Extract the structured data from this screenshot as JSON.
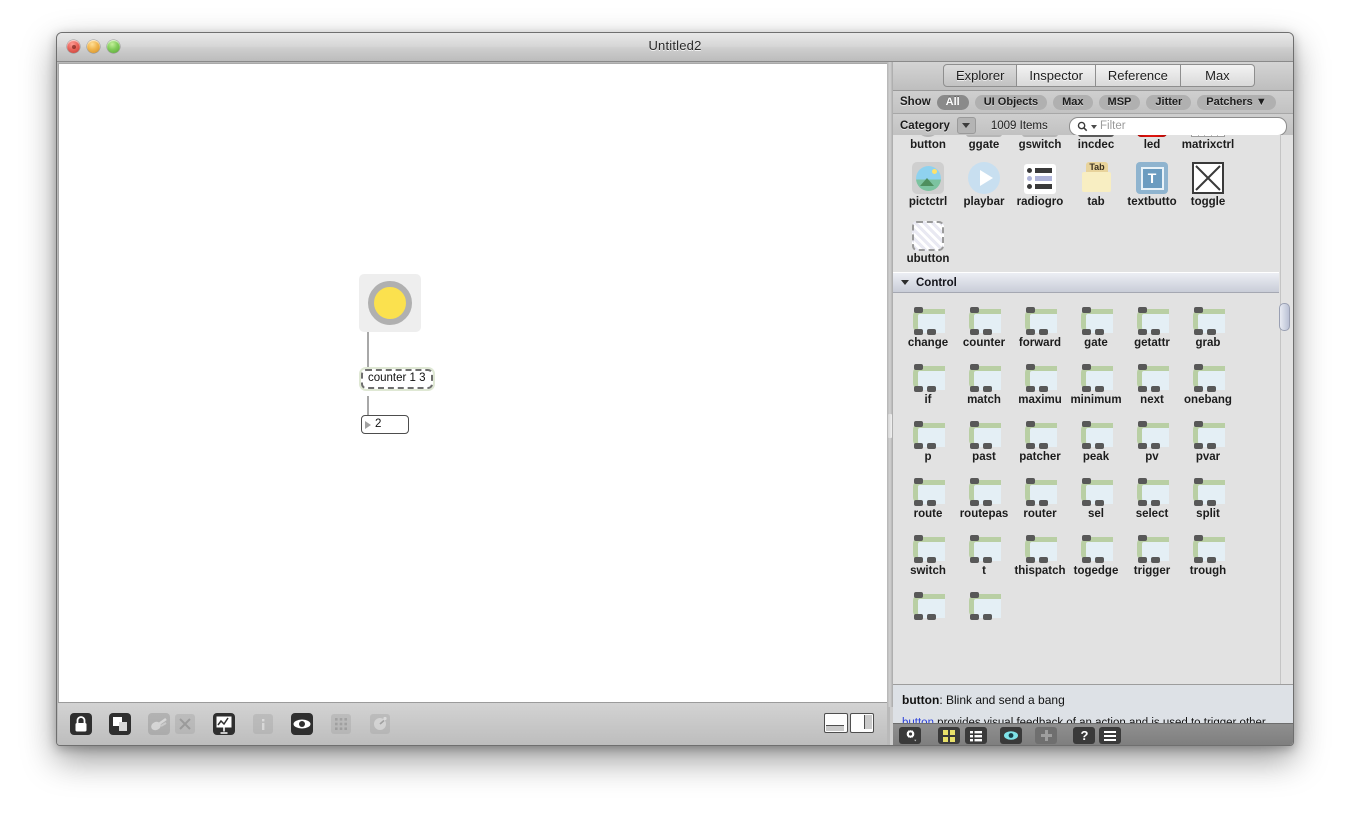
{
  "window": {
    "title": "Untitled2",
    "traffic_lights": [
      "close-button",
      "minimize-button",
      "zoom-button"
    ]
  },
  "patcher": {
    "objects": [
      {
        "type": "bang",
        "name": "bang-object",
        "value": ""
      },
      {
        "type": "object-box",
        "name": "counter-object-box",
        "text": "counter 1 3",
        "selected": true
      },
      {
        "type": "number-box",
        "name": "number-box",
        "text": "2"
      }
    ]
  },
  "patcher_toolbar": {
    "items": [
      {
        "name": "lock-icon",
        "label": "Lock",
        "enabled": true
      },
      {
        "name": "presentation-mode-icon",
        "label": "Presentation",
        "enabled": true
      },
      {
        "name": "scope-icon",
        "label": "Scope",
        "enabled": false
      },
      {
        "name": "close-x-icon",
        "label": "Close",
        "enabled": false
      },
      {
        "name": "signal-probe-icon",
        "label": "Signal Probe",
        "enabled": true
      },
      {
        "name": "info-icon",
        "label": "Info",
        "enabled": false
      },
      {
        "name": "snap-icon",
        "label": "Snap",
        "enabled": true
      },
      {
        "name": "grid-icon",
        "label": "Grid",
        "enabled": false
      },
      {
        "name": "gauge-icon",
        "label": "Gauge",
        "enabled": false
      }
    ],
    "panel_toggles": [
      {
        "name": "bottom-panel-toggle",
        "label": "Bottom Panel"
      },
      {
        "name": "side-panel-toggle",
        "label": "Side Panel"
      }
    ]
  },
  "sidebar": {
    "tabs": [
      {
        "label": "Explorer",
        "active": true
      },
      {
        "label": "Inspector",
        "active": false
      },
      {
        "label": "Reference",
        "active": false
      },
      {
        "label": "Max",
        "active": false
      }
    ],
    "show_row": {
      "label": "Show",
      "filters": [
        {
          "label": "All",
          "selected": true
        },
        {
          "label": "UI Objects",
          "selected": false
        },
        {
          "label": "Max",
          "selected": false
        },
        {
          "label": "MSP",
          "selected": false
        },
        {
          "label": "Jitter",
          "selected": false
        },
        {
          "label": "Patchers ▼",
          "selected": false
        }
      ]
    },
    "category_row": {
      "label": "Category",
      "items_count": "1009 Items",
      "search_placeholder": "Filter",
      "search_value": ""
    },
    "ui_objects": [
      {
        "label": "button",
        "icon": "bang-icon"
      },
      {
        "label": "ggate",
        "icon": "ggate-icon"
      },
      {
        "label": "gswitch",
        "icon": "gswitch-icon"
      },
      {
        "label": "incdec",
        "icon": "incdec-icon"
      },
      {
        "label": "led",
        "icon": "led-icon"
      },
      {
        "label": "matrixctrl",
        "icon": "matrixctrl-icon"
      },
      {
        "label": "pictctrl",
        "icon": "pictctrl-icon"
      },
      {
        "label": "playbar",
        "icon": "playbar-icon"
      },
      {
        "label": "radiogro",
        "icon": "radiogroup-icon"
      },
      {
        "label": "tab",
        "icon": "tab-icon"
      },
      {
        "label": "textbutto",
        "icon": "textbutton-icon"
      },
      {
        "label": "toggle",
        "icon": "toggle-icon"
      },
      {
        "label": "ubutton",
        "icon": "ubutton-icon"
      }
    ],
    "control_section": {
      "title": "Control",
      "expanded": true,
      "objects": [
        "change",
        "counter",
        "forward",
        "gate",
        "getattr",
        "grab",
        "if",
        "match",
        "maximu",
        "minimum",
        "next",
        "onebang",
        "p",
        "past",
        "patcher",
        "peak",
        "pv",
        "pvar",
        "route",
        "routepas",
        "router",
        "sel",
        "select",
        "split",
        "switch",
        "t",
        "thispatch",
        "togedge",
        "trigger",
        "trough",
        "",
        ""
      ]
    },
    "description": {
      "heading_object": "button",
      "heading_rest": ": Blink and send a bang",
      "body_link": "button",
      "body_rest": " provides visual feedback of an action and is used to trigger other messages and processes."
    },
    "bottom_toolbar": [
      {
        "name": "gear-icon",
        "label": "Settings",
        "state": "normal"
      },
      {
        "name": "grid-view-icon",
        "label": "Grid View",
        "state": "active"
      },
      {
        "name": "list-view-icon",
        "label": "List View",
        "state": "normal"
      },
      {
        "name": "eye-icon",
        "label": "Preview",
        "state": "normal"
      },
      {
        "name": "plus-icon",
        "label": "Add",
        "state": "disabled"
      },
      {
        "name": "help-icon",
        "label": "Help",
        "state": "normal"
      },
      {
        "name": "menu-icon",
        "label": "Menu",
        "state": "normal"
      }
    ]
  },
  "colors": {
    "bang_yellow": "#fbe14e",
    "object_body": "#e4eff5",
    "object_border": "#b9cfa4",
    "link_blue": "#2a3fd8",
    "grid_view_yellow": "#e8e06a",
    "eye_cyan": "#7fe3e8"
  }
}
